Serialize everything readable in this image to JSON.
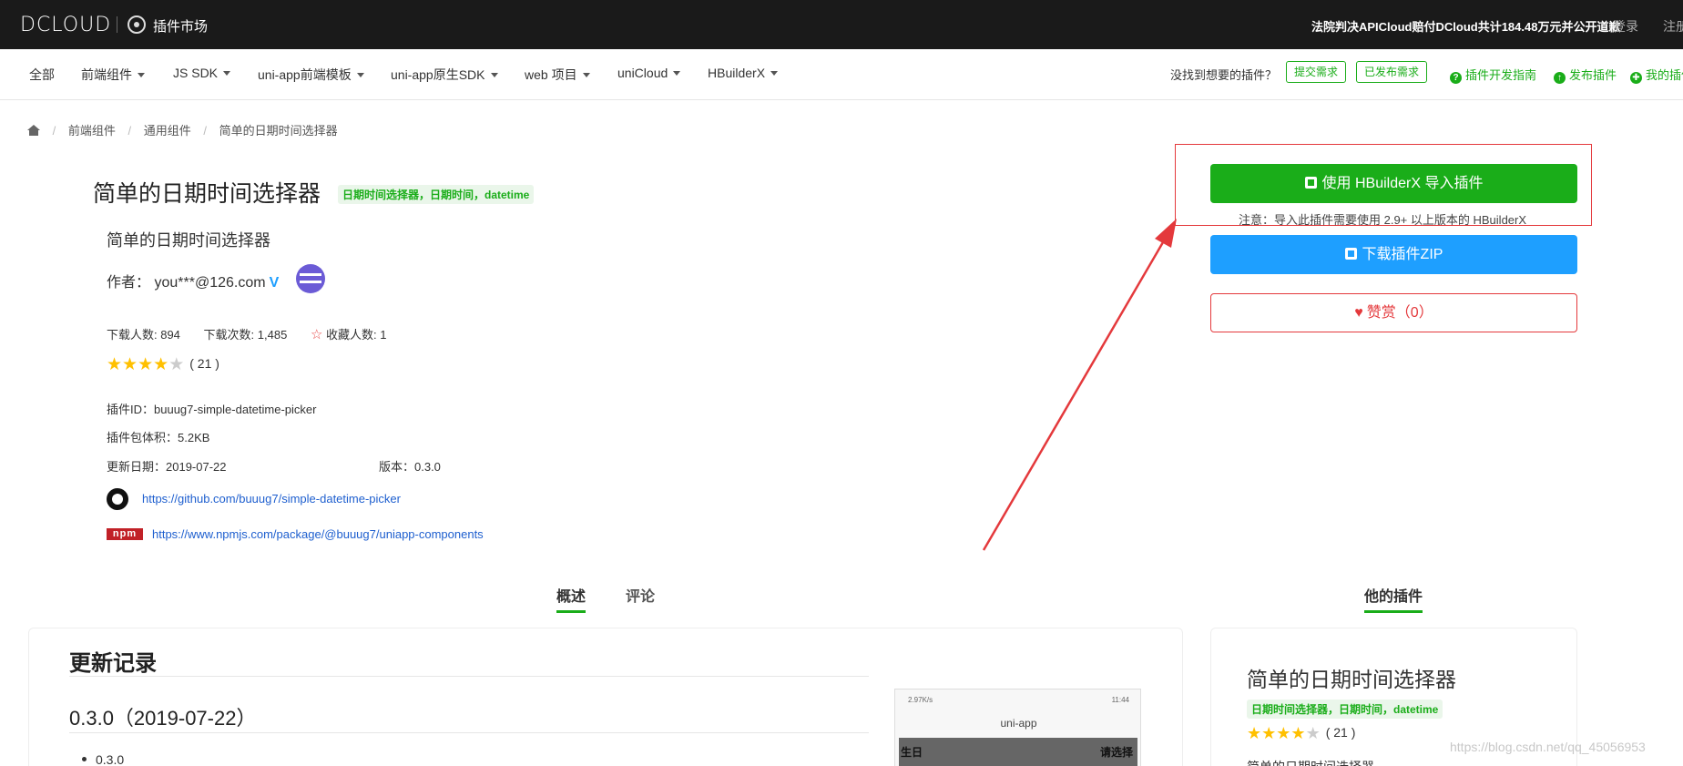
{
  "topbar": {
    "logo": "DCLOUD",
    "market_label": "插件市场",
    "notice": "法院判决APICloud赔付DCloud共计184.48万元并公开道歉",
    "login": "登录",
    "register": "注册"
  },
  "catnav": {
    "items": [
      "全部",
      "前端组件",
      "JS SDK",
      "uni-app前端模板",
      "uni-app原生SDK",
      "web 项目",
      "uniCloud",
      "HBuilderX"
    ],
    "question": "没找到想要的插件？",
    "submit_request": "提交需求",
    "published_request": "已发布需求",
    "dev_guide": "插件开发指南",
    "publish_plugin": "发布插件",
    "my_plugins": "我的插件"
  },
  "breadcrumb": [
    "前端组件",
    "通用组件",
    "简单的日期时间选择器"
  ],
  "plugin": {
    "title": "简单的日期时间选择器",
    "tags": "日期时间选择器，日期时间，datetime",
    "description": "简单的日期时间选择器",
    "author_label": "作者：",
    "author": "you***@126.com",
    "verified_mark": "V",
    "stats": {
      "downloads_users": "下载人数: 894",
      "downloads_count": "下载次数: 1,485",
      "favorites": "收藏人数: 1"
    },
    "rating": {
      "value": 4,
      "max": 5,
      "count": "( 21 )"
    },
    "plugin_id": "插件ID：buuug7-simple-datetime-picker",
    "size": "插件包体积：5.2KB",
    "updated": "更新日期：2019-07-22",
    "version": "版本：0.3.0",
    "github_url": "https://github.com/buuug7/simple-datetime-picker",
    "npm_label": "npm",
    "npm_url": "https://www.npmjs.com/package/@buuug7/uniapp-components"
  },
  "actions": {
    "import_button": "使用 HBuilderX 导入插件",
    "import_note": "注意：导入此插件需要使用 2.9+ 以上版本的 HBuilderX",
    "zip_button": "下载插件ZIP",
    "like_button": "赞赏（0）"
  },
  "tabs": {
    "overview": "概述",
    "comments": "评论",
    "his_plugins": "他的插件"
  },
  "changelog": {
    "title": "更新记录",
    "version_heading": "0.3.0（2019-07-22）",
    "items": [
      "0.3.0"
    ]
  },
  "phone_preview": {
    "status_left": "2.97K/s",
    "status_right": "11:44",
    "title": "uni-app",
    "row_label": "生日",
    "row_value": "请选择"
  },
  "other_plugin": {
    "title": "简单的日期时间选择器",
    "tags": "日期时间选择器，日期时间，datetime",
    "rating": {
      "value": 4,
      "max": 5,
      "count": "( 21 )"
    },
    "description": "简单的日期时间选择器"
  },
  "watermark": "https://blog.csdn.net/qq_45056953",
  "colors": {
    "brand_green": "#1aad19",
    "blue": "#1e9fff",
    "red": "#e4393c",
    "star": "#ffc000"
  }
}
